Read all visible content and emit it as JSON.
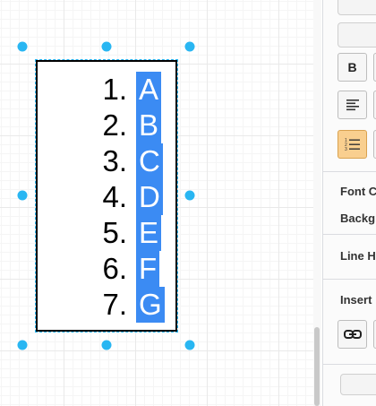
{
  "list": {
    "items": [
      {
        "num": "1.",
        "letter": "A"
      },
      {
        "num": "2.",
        "letter": "B"
      },
      {
        "num": "3.",
        "letter": "C"
      },
      {
        "num": "4.",
        "letter": "D"
      },
      {
        "num": "5.",
        "letter": "E"
      },
      {
        "num": "6.",
        "letter": "F"
      },
      {
        "num": "7.",
        "letter": "G"
      }
    ]
  },
  "panel": {
    "bold_label": "B",
    "font_color_label": "Font C",
    "background_label": "Backg",
    "line_height_label": "Line H",
    "insert_label": "Insert"
  },
  "colors": {
    "selection": "#3b8bf3",
    "handle": "#29b6f2",
    "active_button": "#f9cf8f"
  }
}
